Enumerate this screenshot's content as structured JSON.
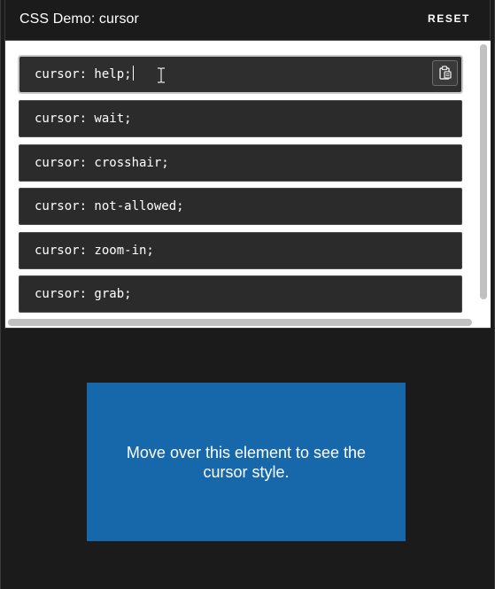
{
  "header": {
    "title": "CSS Demo: cursor",
    "reset_label": "RESET"
  },
  "choices": [
    {
      "code": "cursor: help;",
      "selected": true
    },
    {
      "code": "cursor: wait;",
      "selected": false
    },
    {
      "code": "cursor: crosshair;",
      "selected": false
    },
    {
      "code": "cursor: not-allowed;",
      "selected": false
    },
    {
      "code": "cursor: zoom-in;",
      "selected": false
    },
    {
      "code": "cursor: grab;",
      "selected": false
    }
  ],
  "icons": {
    "copy": "clipboard-icon",
    "text_cursor": "i-beam-cursor-icon"
  },
  "output": {
    "example_text": "Move over this element to see the cursor style."
  },
  "colors": {
    "background": "#1b1b1b",
    "choice_background": "#2b2b2b",
    "example_background": "#1767ab",
    "text": "#ffffff"
  }
}
